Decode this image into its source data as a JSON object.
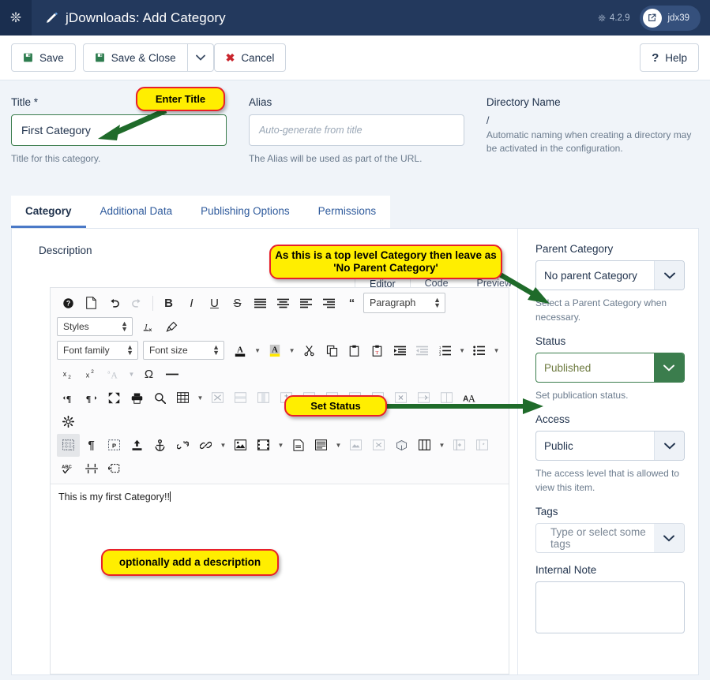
{
  "topbar": {
    "logo_icon": "joomla-logo-icon",
    "edit_icon": "pencil-icon",
    "title": "jDownloads: Add Category",
    "version_icon": "joomla-mark-icon",
    "version": "4.2.9",
    "user_icon": "external-link-icon",
    "user_name": "jdx39",
    "bg_color": "#23395d"
  },
  "toolbar": {
    "save_label": "Save",
    "save_close_label": "Save & Close",
    "dropdown_icon": "chevron-down-icon",
    "cancel_label": "Cancel",
    "cancel_icon": "x-icon",
    "help_label": "Help",
    "help_icon": "question-mark-icon"
  },
  "fields": {
    "title": {
      "label": "Title *",
      "value": "First Category",
      "hint": "Title for this category."
    },
    "alias": {
      "label": "Alias",
      "placeholder": "Auto-generate from title",
      "hint": "The Alias will be used as part of the URL."
    },
    "directory": {
      "label": "Directory Name",
      "path": "/",
      "hint": "Automatic naming when creating a directory may be activated in the configuration."
    }
  },
  "tabs": [
    {
      "label": "Category",
      "active": true
    },
    {
      "label": "Additional Data",
      "active": false
    },
    {
      "label": "Publishing Options",
      "active": false
    },
    {
      "label": "Permissions",
      "active": false
    }
  ],
  "editor": {
    "description_label": "Description",
    "mode_tabs": [
      {
        "label": "Editor",
        "active": true
      },
      {
        "label": "Code",
        "active": false
      },
      {
        "label": "Preview",
        "active": false
      }
    ],
    "body_text": "This is my first Category!!",
    "selects": {
      "styles": "Styles",
      "font_family": "Font family",
      "font_size": "Font size",
      "paragraph": "Paragraph"
    },
    "toolbar_rows": [
      [
        "help-icon",
        "new-document-icon",
        "undo-icon",
        "redo-icon",
        "sep",
        "bold-icon",
        "italic-icon",
        "underline-icon",
        "strikethrough-icon",
        "align-justify-icon",
        "align-center-icon",
        "align-left-icon",
        "align-right-icon",
        "blockquote-icon"
      ],
      [
        "styles-select",
        "remove-format-icon",
        "clear-formatting-brush-icon"
      ],
      [
        "font-family-select",
        "font-size-select",
        "text-color-icon",
        "text-color-caret",
        "background-color-icon",
        "background-color-caret",
        "cut-icon",
        "copy-icon",
        "paste-icon",
        "paste-as-text-icon",
        "indent-icon",
        "outdent-icon",
        "numbered-list-icon",
        "numbered-list-caret",
        "bullet-list-icon",
        "bullet-list-caret"
      ],
      [
        "subscript-icon",
        "superscript-icon",
        "spellcheck-language-icon",
        "spellcheck-caret",
        "special-character-icon",
        "horizontal-rule-icon"
      ],
      [
        "ltr-direction-icon",
        "rtl-direction-icon",
        "fullscreen-icon",
        "print-icon",
        "search-replace-icon",
        "table-icon",
        "table-caret",
        "delete-table-icon",
        "table-row-properties-icon",
        "table-cell-properties-icon",
        "insert-row-before-icon",
        "insert-row-after-icon",
        "delete-row-icon",
        "insert-column-before-icon",
        "insert-column-after-icon",
        "delete-column-icon",
        "merge-cells-icon",
        "split-cell-icon",
        "typography-icon"
      ],
      [
        "settings-gear-icon"
      ],
      [
        "show-blocks-icon",
        "show-invisible-chars-icon",
        "page-break-icon",
        "insert-file-icon",
        "anchor-icon",
        "unlink-icon",
        "link-icon",
        "link-caret",
        "image-icon",
        "media-icon",
        "media-caret",
        "article-icon",
        "module-icon",
        "module-caret",
        "insert-template-icon",
        "insert-field-icon",
        "package-icon",
        "columns-icon",
        "columns-caret",
        "add-column-icon",
        "remove-column-icon"
      ],
      [
        "spellchecker-icon",
        "page-break-line-icon",
        "insert-nonbreaking-icon"
      ]
    ]
  },
  "sidebar": {
    "parent_category": {
      "label": "Parent Category",
      "value": "No parent Category",
      "icon": "chevron-down-icon",
      "hint": "Select a Parent Category when necessary."
    },
    "status": {
      "label": "Status",
      "value": "Published",
      "icon": "chevron-down-icon",
      "hint": "Set publication status.",
      "accent_color": "#3b7d4d"
    },
    "access": {
      "label": "Access",
      "value": "Public",
      "icon": "chevron-down-icon",
      "hint": "The access level that is allowed to view this item."
    },
    "tags": {
      "label": "Tags",
      "placeholder": "Type or select some tags",
      "icon": "chevron-down-icon"
    },
    "internal_note": {
      "label": "Internal Note",
      "value": ""
    }
  },
  "callouts": [
    {
      "id": "co-title",
      "text": "Enter Title"
    },
    {
      "id": "co-parent",
      "text": "As this is a top level Category then leave as 'No Parent Category'"
    },
    {
      "id": "co-status",
      "text": "Set Status"
    },
    {
      "id": "co-desc",
      "text": "optionally add a description"
    }
  ],
  "colors": {
    "callout_fill": "#ffee00",
    "callout_border": "#e8202a",
    "arrow": "#1f6b2a",
    "accent_blue": "#4a79c7"
  }
}
